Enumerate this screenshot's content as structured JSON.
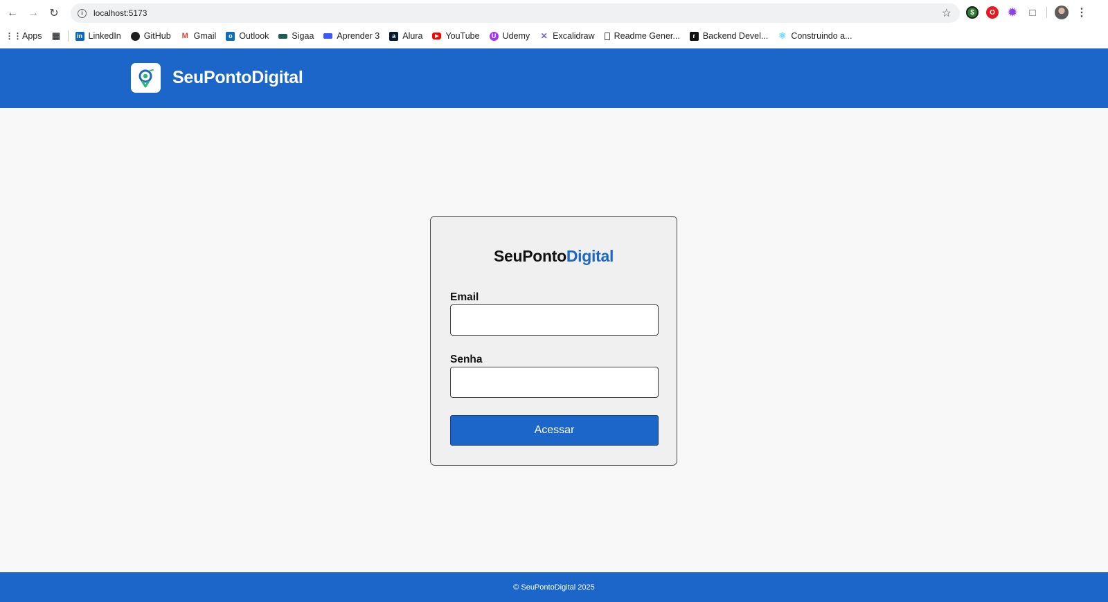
{
  "browser": {
    "url": "localhost:5173",
    "bookmarks": [
      {
        "label": "Apps",
        "icon": "apps-grid-icon"
      },
      {
        "label": "LinkedIn",
        "icon": "linkedin-icon",
        "color": "#0a66c2"
      },
      {
        "label": "GitHub",
        "icon": "github-icon",
        "color": "#1f1f1f"
      },
      {
        "label": "Gmail",
        "icon": "gmail-icon",
        "color": "#ea4335"
      },
      {
        "label": "Outlook",
        "icon": "outlook-icon",
        "color": "#0f6cbd"
      },
      {
        "label": "Sigaa",
        "icon": "sigaa-icon",
        "color": "#1b5e55"
      },
      {
        "label": "Aprender 3",
        "icon": "aprender-icon",
        "color": "#3d5afe"
      },
      {
        "label": "Alura",
        "icon": "alura-icon",
        "color": "#051933"
      },
      {
        "label": "YouTube",
        "icon": "youtube-icon",
        "color": "#ff0000"
      },
      {
        "label": "Udemy",
        "icon": "udemy-icon",
        "color": "#a435f0"
      },
      {
        "label": "Excalidraw",
        "icon": "excalidraw-icon",
        "color": "#6965db"
      },
      {
        "label": "Readme Gener...",
        "icon": "readme-icon",
        "color": "#444444"
      },
      {
        "label": "Backend Devel...",
        "icon": "roadmap-icon",
        "color": "#111111"
      },
      {
        "label": "Construindo a...",
        "icon": "react-icon",
        "color": "#61dafb"
      }
    ]
  },
  "header": {
    "brand": "SeuPontoDigital",
    "color": "#1b66c8"
  },
  "login": {
    "title_main": "SeuPonto",
    "title_accent": "Digital",
    "email_label": "Email",
    "email_value": "",
    "password_label": "Senha",
    "password_value": "",
    "submit_label": "Acessar"
  },
  "footer": {
    "text": "© SeuPontoDigital 2025"
  }
}
